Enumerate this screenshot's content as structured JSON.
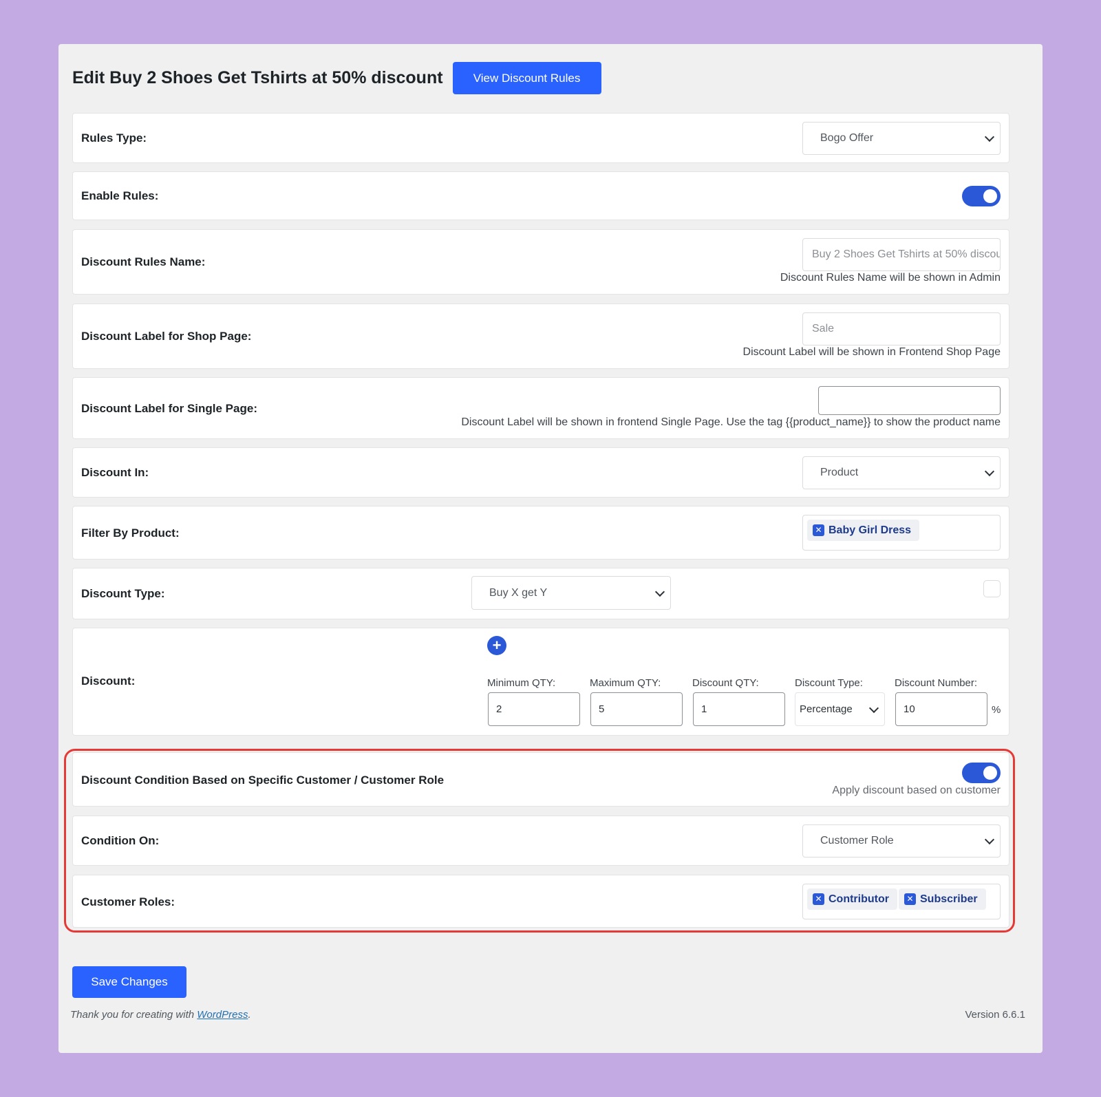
{
  "header": {
    "title": "Edit Buy 2 Shoes Get Tshirts at 50% discount",
    "view_button": "View Discount Rules"
  },
  "rules_type": {
    "label": "Rules Type:",
    "value": "Bogo Offer"
  },
  "enable_rules": {
    "label": "Enable Rules:",
    "enabled": true
  },
  "rules_name": {
    "label": "Discount Rules Name:",
    "value": "Buy 2 Shoes Get Tshirts at 50% discour",
    "help": "Discount Rules Name will be shown in Admin"
  },
  "shop_label": {
    "label": "Discount Label for Shop Page:",
    "value": "Sale",
    "help": "Discount Label will be shown in Frontend Shop Page"
  },
  "single_label": {
    "label": "Discount Label for Single Page:",
    "value": "",
    "help": "Discount Label will be shown in frontend Single Page. Use the tag {{product_name}} to show the product name"
  },
  "discount_in": {
    "label": "Discount In:",
    "value": "Product"
  },
  "filter_product": {
    "label": "Filter By Product:",
    "tags": [
      "Baby Girl Dress"
    ]
  },
  "discount_type": {
    "label": "Discount Type:",
    "value": "Buy X get Y"
  },
  "discount": {
    "label": "Discount:",
    "min_qty_label": "Minimum QTY:",
    "min_qty": "2",
    "max_qty_label": "Maximum QTY:",
    "max_qty": "5",
    "disc_qty_label": "Discount QTY:",
    "disc_qty": "1",
    "type_label": "Discount Type:",
    "type_value": "Percentage",
    "number_label": "Discount Number:",
    "number_value": "10",
    "unit": "%"
  },
  "customer_condition": {
    "label": "Discount Condition Based on Specific Customer / Customer Role",
    "enabled": true,
    "help": "Apply discount based on customer"
  },
  "condition_on": {
    "label": "Condition On:",
    "value": "Customer Role"
  },
  "customer_roles": {
    "label": "Customer Roles:",
    "tags": [
      "Contributor",
      "Subscriber"
    ]
  },
  "save_button": "Save Changes",
  "footer": {
    "thanks_prefix": "Thank you for creating with ",
    "link": "WordPress",
    "suffix": ".",
    "version": "Version 6.6.1"
  },
  "colors": {
    "accent": "#2962ff",
    "highlight": "#e53935",
    "background": "#c3aae2"
  }
}
